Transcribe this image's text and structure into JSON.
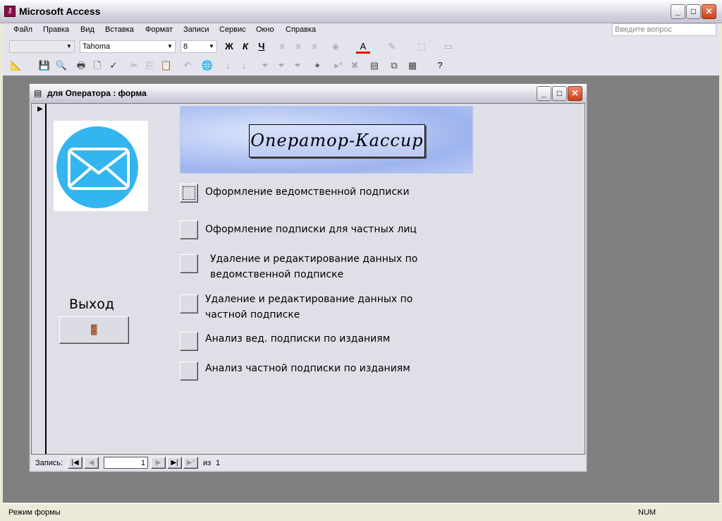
{
  "app": {
    "title": "Microsoft Access"
  },
  "menu": [
    "Файл",
    "Правка",
    "Вид",
    "Вставка",
    "Формат",
    "Записи",
    "Сервис",
    "Окно",
    "Справка"
  ],
  "ask_placeholder": "Введите вопрос",
  "format_toolbar": {
    "object_combo": "",
    "font": "Tahoma",
    "size": "8",
    "bold": "Ж",
    "italic": "К",
    "underline": "Ч"
  },
  "form": {
    "title": "для Оператора : форма",
    "banner": "Оператор-Кассир",
    "exit_label": "Выход",
    "options": [
      "Оформление ведомственной подписки",
      "Оформление подписки для частных лиц",
      "Удаление и редактирование данных по ведомственной подписке",
      "Удаление и редактирование данных по частной подписке",
      "Анализ вед. подписки по изданиям",
      "Анализ частной подписки по изданиям"
    ],
    "nav": {
      "label": "Запись:",
      "current": "1",
      "of_label": "из",
      "total": "1"
    }
  },
  "status": {
    "mode": "Режим формы",
    "num": "NUM"
  },
  "colors": {
    "envelope": "#33b5ef",
    "mdi": "#808080"
  }
}
